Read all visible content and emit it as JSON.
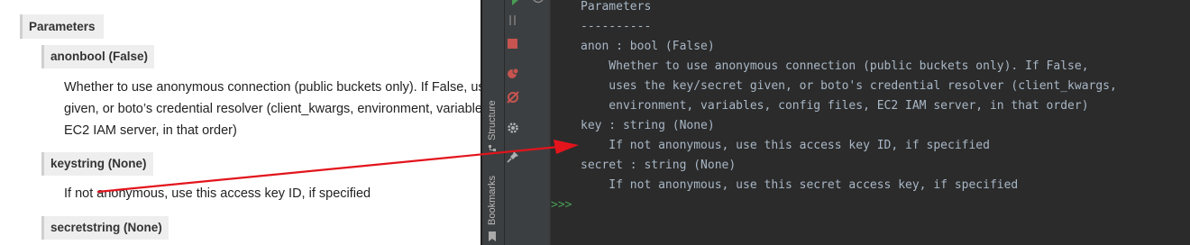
{
  "doc": {
    "parameters_heading": "Parameters",
    "anon_label": "anonbool (False)",
    "anon_desc": [
      "Whether to use anonymous connection (public buckets only). If False, uses the key/secret",
      "given, or boto’s credential resolver (client_kwargs, environment, variables, config files,",
      "EC2 IAM server, in that order)"
    ],
    "key_label": "keystring (None)",
    "key_desc": "If not anonymous, use this access key ID, if specified",
    "secret_label": "secretstring (None)"
  },
  "ide": {
    "structure_label": "Structure",
    "bookmarks_label": "Bookmarks",
    "console_lines": [
      "Parameters",
      "----------",
      "anon : bool (False)",
      "    Whether to use anonymous connection (public buckets only). If False,",
      "    uses the key/secret given, or boto's credential resolver (client_kwargs,",
      "    environment, variables, config files, EC2 IAM server, in that order)",
      "key : string (None)",
      "    If not anonymous, use this access key ID, if specified",
      "secret : string (None)",
      "    If not anonymous, use this secret access key, if specified"
    ],
    "prompt": ">>>"
  },
  "colors": {
    "annotation_arrow": "#e3141c",
    "ide_background": "#2b2b2b",
    "console_text": "#a9b7c6",
    "prompt_green": "#499c54"
  }
}
